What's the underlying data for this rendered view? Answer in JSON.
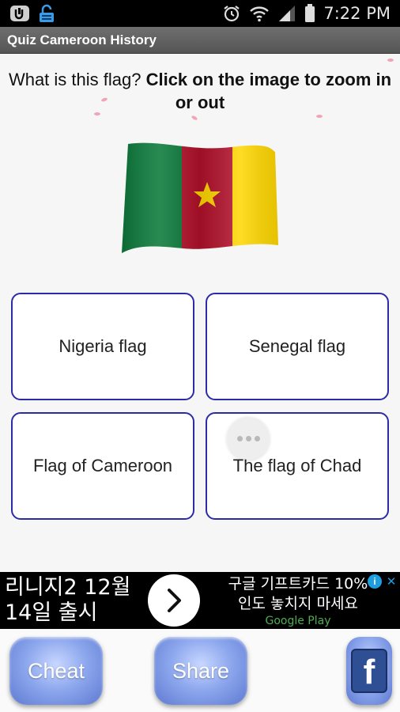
{
  "status_bar": {
    "time": "7:22 PM",
    "icons": [
      "usb-icon",
      "lock-icon",
      "alarm-icon",
      "wifi-icon",
      "signal-icon",
      "battery-icon"
    ]
  },
  "app": {
    "title": "Quiz Cameroon History"
  },
  "question": {
    "prefix": "What is this flag? ",
    "emphasis": "Click on the image to zoom in or out"
  },
  "flag": {
    "colors": [
      "#0b7a3a",
      "#b3112b",
      "#ffd700"
    ],
    "star_color": "#ffd700"
  },
  "answers": [
    {
      "label": "Nigeria flag"
    },
    {
      "label": "Senegal flag"
    },
    {
      "label": "Flag of Cameroon"
    },
    {
      "label": "The flag of Chad"
    }
  ],
  "ad": {
    "left_line1": "리니지2 12월",
    "left_line2": "14일 출시",
    "right_line1": "구글 기프트카드 10%",
    "right_line2": "인도 놓치지 마세요",
    "store": "Google Play"
  },
  "bottom": {
    "cheat_label": "Cheat",
    "share_label": "Share",
    "facebook_glyph": "f"
  }
}
